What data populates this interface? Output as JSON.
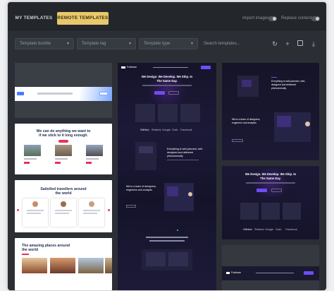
{
  "tabs": {
    "my_templates": "MY TEMPLATES",
    "remote_templates": "REMOTE TEMPLATES"
  },
  "toggles": {
    "import_images": "Import images",
    "replace_content": "Replace content"
  },
  "filters": {
    "bundle": "Template bundle",
    "tag": "Template tag",
    "type": "Template type",
    "search_placeholder": "Search templates..."
  },
  "icons": {
    "refresh": "refresh-icon",
    "add": "plus-icon",
    "save": "save-icon",
    "download": "download-icon",
    "chevron": "chevron-down-icon"
  },
  "colors": {
    "accent": "#e8c86c",
    "panel": "#2b2f35",
    "topbar": "#23272c",
    "purple": "#6f4cf6"
  },
  "templates": {
    "hero_text_1": "We can do anything we want to",
    "hero_text_2": "if we stick to it long enough.",
    "travellers_1": "Satisfied travellers around",
    "travellers_2": "the world",
    "places_1": "The amazing places around",
    "places_2": "the world",
    "dark_brand": "Fodbase",
    "dark_hero_1": "We Design. We Develop. We Ship. In",
    "dark_hero_2": "The Same Day.",
    "dark_logos": [
      "GitHub",
      "Stellaris",
      "Google",
      "Grab",
      "Facebook"
    ],
    "dark_section_1": "Everything is well-planned, well-",
    "dark_section_2": "designed and delivered",
    "dark_section_3": "phenomenally.",
    "dark_team_1": "We're a team of designers,",
    "dark_team_2": "engineers and analysts",
    "dark_right_hero_1": "We Design. We Develop. We Ship. In",
    "dark_right_hero_2": "The Same Day."
  }
}
